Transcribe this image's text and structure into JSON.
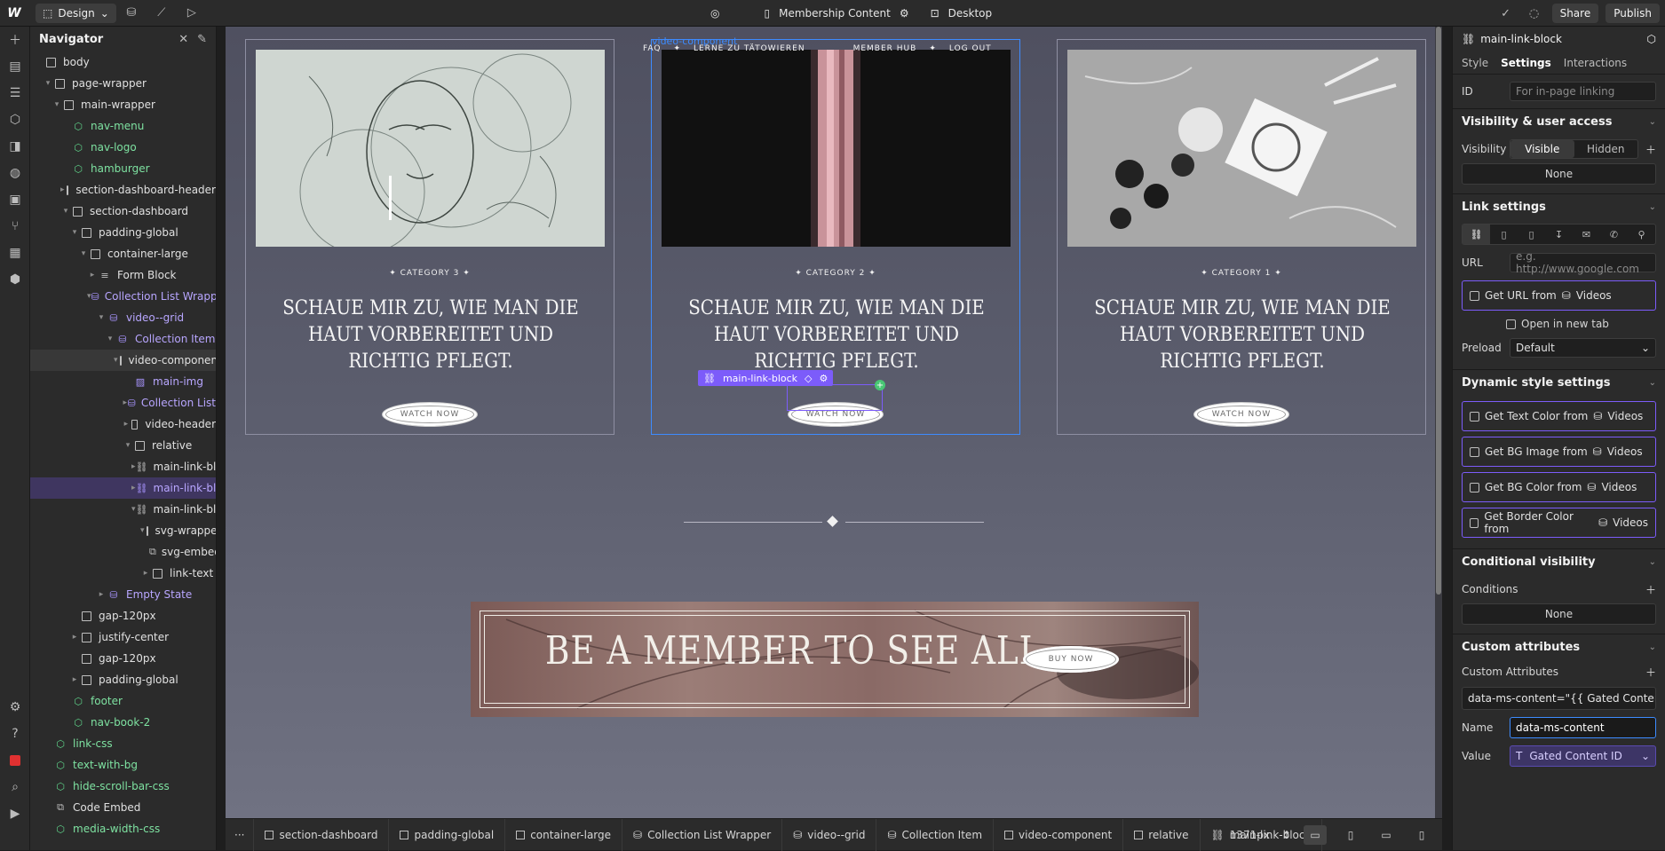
{
  "topbar": {
    "logo": "W",
    "mode_label": "Design",
    "page_name": "Membership Content",
    "breakpoint_label": "Desktop",
    "share_label": "Share",
    "publish_label": "Publish"
  },
  "navigator": {
    "title": "Navigator",
    "rows": [
      {
        "label": "body",
        "indent": 0,
        "caret": "",
        "icon": "box",
        "style": ""
      },
      {
        "label": "page-wrapper",
        "indent": 1,
        "caret": "▾",
        "icon": "box",
        "style": ""
      },
      {
        "label": "main-wrapper",
        "indent": 2,
        "caret": "▾",
        "icon": "box",
        "style": ""
      },
      {
        "label": "nav-menu",
        "indent": 3,
        "caret": "",
        "icon": "component",
        "style": "green"
      },
      {
        "label": "nav-logo",
        "indent": 3,
        "caret": "",
        "icon": "component",
        "style": "green"
      },
      {
        "label": "hamburger",
        "indent": 3,
        "caret": "",
        "icon": "component",
        "style": "green"
      },
      {
        "label": "section-dashboard-header",
        "indent": 3,
        "caret": "▸",
        "icon": "box",
        "style": ""
      },
      {
        "label": "section-dashboard",
        "indent": 3,
        "caret": "▾",
        "icon": "box",
        "style": ""
      },
      {
        "label": "padding-global",
        "indent": 4,
        "caret": "▾",
        "icon": "box",
        "style": ""
      },
      {
        "label": "container-large",
        "indent": 5,
        "caret": "▾",
        "icon": "box",
        "style": ""
      },
      {
        "label": "Form Block",
        "indent": 6,
        "caret": "▸",
        "icon": "form",
        "style": ""
      },
      {
        "label": "Collection List Wrapper",
        "indent": 6,
        "caret": "▾",
        "icon": "collection",
        "style": "purple"
      },
      {
        "label": "video--grid",
        "indent": 7,
        "caret": "▾",
        "icon": "collection",
        "style": "purple"
      },
      {
        "label": "Collection Item",
        "indent": 8,
        "caret": "▾",
        "icon": "collection-item",
        "style": "purple"
      },
      {
        "label": "video-component",
        "indent": 9,
        "caret": "▾",
        "icon": "box",
        "style": "",
        "sel": "dark"
      },
      {
        "label": "main-img",
        "indent": 10,
        "caret": "",
        "icon": "image",
        "style": "purple"
      },
      {
        "label": "Collection List",
        "indent": 10,
        "caret": "▸",
        "icon": "collection",
        "style": "purple"
      },
      {
        "label": "video-header",
        "indent": 10,
        "caret": "▸",
        "icon": "box",
        "style": ""
      },
      {
        "label": "relative",
        "indent": 10,
        "caret": "▾",
        "icon": "box",
        "style": ""
      },
      {
        "label": "main-link-block",
        "indent": 11,
        "caret": "▸",
        "icon": "link",
        "style": ""
      },
      {
        "label": "main-link-block",
        "indent": 11,
        "caret": "▸",
        "icon": "link",
        "style": "purple",
        "sel": "purple"
      },
      {
        "label": "main-link-block",
        "indent": 11,
        "caret": "▾",
        "icon": "link",
        "style": ""
      },
      {
        "label": "svg-wrapper",
        "indent": 12,
        "caret": "▾",
        "icon": "box",
        "style": ""
      },
      {
        "label": "svg-embed",
        "indent": 13,
        "caret": "",
        "icon": "embed",
        "style": ""
      },
      {
        "label": "link-text",
        "indent": 12,
        "caret": "▸",
        "icon": "box",
        "style": ""
      },
      {
        "label": "Empty State",
        "indent": 7,
        "caret": "▸",
        "icon": "collection",
        "style": "purple"
      },
      {
        "label": "gap-120px",
        "indent": 4,
        "caret": "",
        "icon": "box",
        "style": ""
      },
      {
        "label": "justify-center",
        "indent": 4,
        "caret": "▸",
        "icon": "box",
        "style": ""
      },
      {
        "label": "gap-120px",
        "indent": 4,
        "caret": "",
        "icon": "box",
        "style": ""
      },
      {
        "label": "padding-global",
        "indent": 4,
        "caret": "▸",
        "icon": "box",
        "style": ""
      },
      {
        "label": "footer",
        "indent": 3,
        "caret": "",
        "icon": "component",
        "style": "green"
      },
      {
        "label": "nav-book-2",
        "indent": 3,
        "caret": "",
        "icon": "component",
        "style": "green"
      },
      {
        "label": "link-css",
        "indent": 1,
        "caret": "",
        "icon": "component",
        "style": "green"
      },
      {
        "label": "text-with-bg",
        "indent": 1,
        "caret": "",
        "icon": "component",
        "style": "green"
      },
      {
        "label": "hide-scroll-bar-css",
        "indent": 1,
        "caret": "",
        "icon": "component",
        "style": "green"
      },
      {
        "label": "Code Embed",
        "indent": 1,
        "caret": "",
        "icon": "embed",
        "style": ""
      },
      {
        "label": "media-width-css",
        "indent": 1,
        "caret": "",
        "icon": "component",
        "style": "green"
      }
    ]
  },
  "canvas": {
    "component_tag": "video-component",
    "overnav": [
      "FAQ",
      "✦",
      "LERNE ZU TÄTOWIEREN",
      "MEMBER HUB",
      "✦",
      "LOG OUT"
    ],
    "cards": [
      {
        "category": "✦   CATEGORY 3   ✦",
        "title": "SCHAUE MIR ZU, WIE MAN DIE HAUT VORBEREITET UND RICHTIG PFLEGT.",
        "button": "WATCH NOW"
      },
      {
        "category": "✦   CATEGORY 2   ✦",
        "title": "SCHAUE MIR ZU, WIE MAN DIE HAUT VORBEREITET UND RICHTIG PFLEGT.",
        "button": "WATCH NOW"
      },
      {
        "category": "✦   CATEGORY 1   ✦",
        "title": "SCHAUE MIR ZU, WIE MAN DIE HAUT VORBEREITET UND RICHTIG PFLEGT.",
        "button": "WATCH NOW"
      }
    ],
    "selection_label": "main-link-block",
    "banner_title": "BE A MEMBER TO SEE ALL",
    "banner_button": "BUY NOW"
  },
  "breadcrumbs": [
    "section-dashboard",
    "padding-global",
    "container-large",
    "Collection List Wrapper",
    "video--grid",
    "Collection Item",
    "video-component",
    "relative",
    "main-link-block"
  ],
  "bottombar": {
    "width_readout": "1371px"
  },
  "settings": {
    "element_name": "main-link-block",
    "tabs": [
      "Style",
      "Settings",
      "Interactions"
    ],
    "id_label": "ID",
    "id_placeholder": "For in-page linking",
    "visibility_section": "Visibility & user access",
    "visibility_label": "Visibility",
    "visible": "Visible",
    "hidden": "Hidden",
    "visibility_none": "None",
    "link_section": "Link settings",
    "url_label": "URL",
    "url_placeholder": "e.g. http://www.google.com",
    "get_url_from": "Get URL from",
    "collection_name": "Videos",
    "open_new_tab": "Open in new tab",
    "preload_label": "Preload",
    "preload_value": "Default",
    "dynamic_section": "Dynamic style settings",
    "dynamic_items": [
      "Get Text Color from",
      "Get BG Image from",
      "Get BG Color from",
      "Get Border Color from"
    ],
    "conditional_section": "Conditional visibility",
    "conditions_label": "Conditions",
    "conditions_none": "None",
    "custom_section": "Custom attributes",
    "custom_label": "Custom Attributes",
    "attribute_preview": "data-ms-content=\"{{ Gated Content I",
    "name_label": "Name",
    "name_value": "data-ms-content",
    "value_label": "Value",
    "value_value": "Gated Content ID"
  }
}
